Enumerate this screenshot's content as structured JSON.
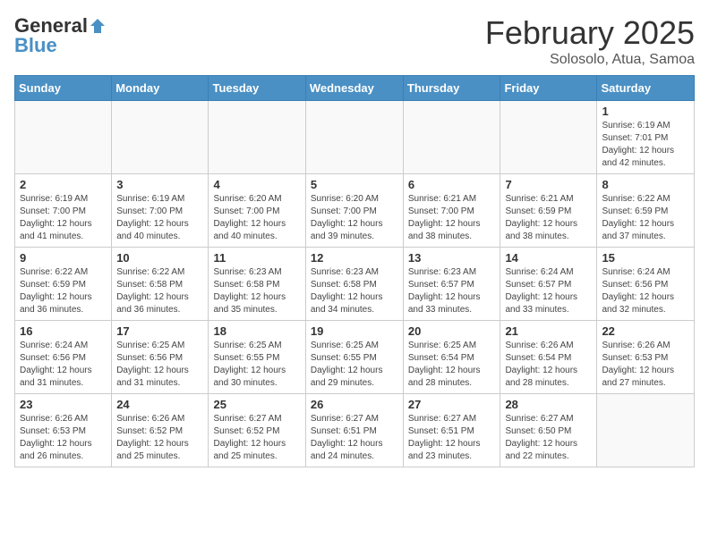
{
  "header": {
    "logo_general": "General",
    "logo_blue": "Blue",
    "month": "February 2025",
    "location": "Solosolo, Atua, Samoa"
  },
  "days_of_week": [
    "Sunday",
    "Monday",
    "Tuesday",
    "Wednesday",
    "Thursday",
    "Friday",
    "Saturday"
  ],
  "weeks": [
    [
      {
        "day": "",
        "info": ""
      },
      {
        "day": "",
        "info": ""
      },
      {
        "day": "",
        "info": ""
      },
      {
        "day": "",
        "info": ""
      },
      {
        "day": "",
        "info": ""
      },
      {
        "day": "",
        "info": ""
      },
      {
        "day": "1",
        "info": "Sunrise: 6:19 AM\nSunset: 7:01 PM\nDaylight: 12 hours and 42 minutes."
      }
    ],
    [
      {
        "day": "2",
        "info": "Sunrise: 6:19 AM\nSunset: 7:00 PM\nDaylight: 12 hours and 41 minutes."
      },
      {
        "day": "3",
        "info": "Sunrise: 6:19 AM\nSunset: 7:00 PM\nDaylight: 12 hours and 40 minutes."
      },
      {
        "day": "4",
        "info": "Sunrise: 6:20 AM\nSunset: 7:00 PM\nDaylight: 12 hours and 40 minutes."
      },
      {
        "day": "5",
        "info": "Sunrise: 6:20 AM\nSunset: 7:00 PM\nDaylight: 12 hours and 39 minutes."
      },
      {
        "day": "6",
        "info": "Sunrise: 6:21 AM\nSunset: 7:00 PM\nDaylight: 12 hours and 38 minutes."
      },
      {
        "day": "7",
        "info": "Sunrise: 6:21 AM\nSunset: 6:59 PM\nDaylight: 12 hours and 38 minutes."
      },
      {
        "day": "8",
        "info": "Sunrise: 6:22 AM\nSunset: 6:59 PM\nDaylight: 12 hours and 37 minutes."
      }
    ],
    [
      {
        "day": "9",
        "info": "Sunrise: 6:22 AM\nSunset: 6:59 PM\nDaylight: 12 hours and 36 minutes."
      },
      {
        "day": "10",
        "info": "Sunrise: 6:22 AM\nSunset: 6:58 PM\nDaylight: 12 hours and 36 minutes."
      },
      {
        "day": "11",
        "info": "Sunrise: 6:23 AM\nSunset: 6:58 PM\nDaylight: 12 hours and 35 minutes."
      },
      {
        "day": "12",
        "info": "Sunrise: 6:23 AM\nSunset: 6:58 PM\nDaylight: 12 hours and 34 minutes."
      },
      {
        "day": "13",
        "info": "Sunrise: 6:23 AM\nSunset: 6:57 PM\nDaylight: 12 hours and 33 minutes."
      },
      {
        "day": "14",
        "info": "Sunrise: 6:24 AM\nSunset: 6:57 PM\nDaylight: 12 hours and 33 minutes."
      },
      {
        "day": "15",
        "info": "Sunrise: 6:24 AM\nSunset: 6:56 PM\nDaylight: 12 hours and 32 minutes."
      }
    ],
    [
      {
        "day": "16",
        "info": "Sunrise: 6:24 AM\nSunset: 6:56 PM\nDaylight: 12 hours and 31 minutes."
      },
      {
        "day": "17",
        "info": "Sunrise: 6:25 AM\nSunset: 6:56 PM\nDaylight: 12 hours and 31 minutes."
      },
      {
        "day": "18",
        "info": "Sunrise: 6:25 AM\nSunset: 6:55 PM\nDaylight: 12 hours and 30 minutes."
      },
      {
        "day": "19",
        "info": "Sunrise: 6:25 AM\nSunset: 6:55 PM\nDaylight: 12 hours and 29 minutes."
      },
      {
        "day": "20",
        "info": "Sunrise: 6:25 AM\nSunset: 6:54 PM\nDaylight: 12 hours and 28 minutes."
      },
      {
        "day": "21",
        "info": "Sunrise: 6:26 AM\nSunset: 6:54 PM\nDaylight: 12 hours and 28 minutes."
      },
      {
        "day": "22",
        "info": "Sunrise: 6:26 AM\nSunset: 6:53 PM\nDaylight: 12 hours and 27 minutes."
      }
    ],
    [
      {
        "day": "23",
        "info": "Sunrise: 6:26 AM\nSunset: 6:53 PM\nDaylight: 12 hours and 26 minutes."
      },
      {
        "day": "24",
        "info": "Sunrise: 6:26 AM\nSunset: 6:52 PM\nDaylight: 12 hours and 25 minutes."
      },
      {
        "day": "25",
        "info": "Sunrise: 6:27 AM\nSunset: 6:52 PM\nDaylight: 12 hours and 25 minutes."
      },
      {
        "day": "26",
        "info": "Sunrise: 6:27 AM\nSunset: 6:51 PM\nDaylight: 12 hours and 24 minutes."
      },
      {
        "day": "27",
        "info": "Sunrise: 6:27 AM\nSunset: 6:51 PM\nDaylight: 12 hours and 23 minutes."
      },
      {
        "day": "28",
        "info": "Sunrise: 6:27 AM\nSunset: 6:50 PM\nDaylight: 12 hours and 22 minutes."
      },
      {
        "day": "",
        "info": ""
      }
    ]
  ]
}
